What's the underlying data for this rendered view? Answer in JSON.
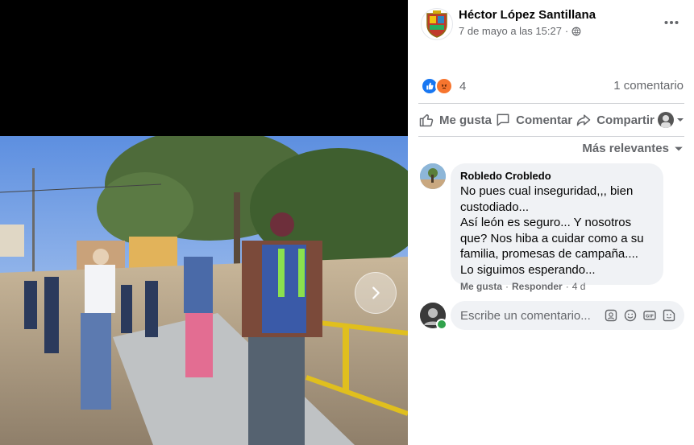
{
  "post": {
    "author": "Héctor López Santillana",
    "date": "7 de mayo a las 15:27",
    "privacy_icon": "globe-icon",
    "reaction_count": "4",
    "reactions": [
      "like-icon",
      "angry-icon"
    ],
    "comment_count": "1 comentario"
  },
  "actions": {
    "like": "Me gusta",
    "comment": "Comentar",
    "share": "Compartir"
  },
  "sort_label": "Más relevantes",
  "comment": {
    "author": "Robledo Crobledo",
    "text": "No pues cual inseguridad,,, bien custodiado...\nAsí león es seguro... Y nosotros que? Nos hiba a cuidar como a su familia, promesas de campaña.... Lo siguimos esperando...",
    "like": "Me gusta",
    "separator": "·",
    "reply": "Responder",
    "time": "4 d"
  },
  "composer": {
    "placeholder": "Escribe un comentario..."
  },
  "colors": {
    "accent": "#1877f2",
    "angry": "#f7752e",
    "muted": "#65676b",
    "bubble": "#f0f2f5"
  }
}
